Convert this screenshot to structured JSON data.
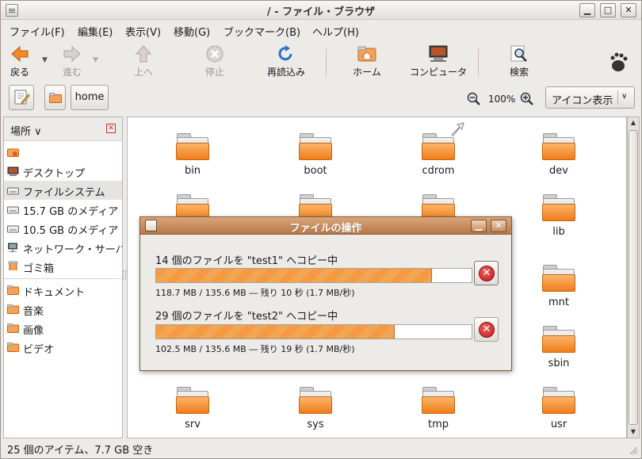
{
  "window": {
    "title": "/ - ファイル・ブラウザ",
    "minimize": "▁",
    "maximize": "□",
    "close": "✕"
  },
  "menubar": [
    "ファイル(F)",
    "編集(E)",
    "表示(V)",
    "移動(G)",
    "ブックマーク(B)",
    "ヘルプ(H)"
  ],
  "toolbar": {
    "back": "戻る",
    "forward": "進む",
    "up": "上へ",
    "stop": "停止",
    "reload": "再読込み",
    "home": "ホーム",
    "computer": "コンピュータ",
    "search": "検索"
  },
  "location": {
    "path_button": "home",
    "zoom": "100%",
    "view_mode": "アイコン表示"
  },
  "sidebar": {
    "header": "場所",
    "items": [
      {
        "label": "",
        "icon": "home-folder-icon"
      },
      {
        "label": "デスクトップ",
        "icon": "desktop-icon"
      },
      {
        "label": "ファイルシステム",
        "icon": "drive-icon"
      },
      {
        "label": "15.7 GB のメディア",
        "icon": "drive-icon"
      },
      {
        "label": "10.5 GB のメディア",
        "icon": "drive-icon"
      },
      {
        "label": "ネットワーク・サーバ",
        "icon": "network-icon"
      },
      {
        "label": "ゴミ箱",
        "icon": "trash-icon"
      },
      {
        "label": "ドキュメント",
        "icon": "folder-icon"
      },
      {
        "label": "音楽",
        "icon": "folder-icon"
      },
      {
        "label": "画像",
        "icon": "folder-icon"
      },
      {
        "label": "ビデオ",
        "icon": "folder-icon"
      }
    ]
  },
  "files": {
    "row1": [
      "bin",
      "boot",
      "cdrom",
      "dev"
    ],
    "lib": "lib",
    "mnt": "mnt",
    "sbin": "sbin",
    "row_last": [
      "srv",
      "sys",
      "tmp",
      "usr"
    ]
  },
  "status": "25 個のアイテム、7.7 GB 空き",
  "dialog": {
    "title": "ファイルの操作",
    "ops": [
      {
        "label": "14 個のファイルを \"test1\" へコピー中",
        "detail": "118.7 MB / 135.6 MB ― 残り 10 秒 (1.7 MB/秒)",
        "progress": 0.875
      },
      {
        "label": "29 個のファイルを \"test2\" へコピー中",
        "detail": "102.5 MB / 135.6 MB ― 残り 19 秒 (1.7 MB/秒)",
        "progress": 0.756
      }
    ]
  },
  "colors": {
    "accent": "#f07c1a",
    "dialog_title": "#b8784a",
    "cancel": "#c01818"
  }
}
